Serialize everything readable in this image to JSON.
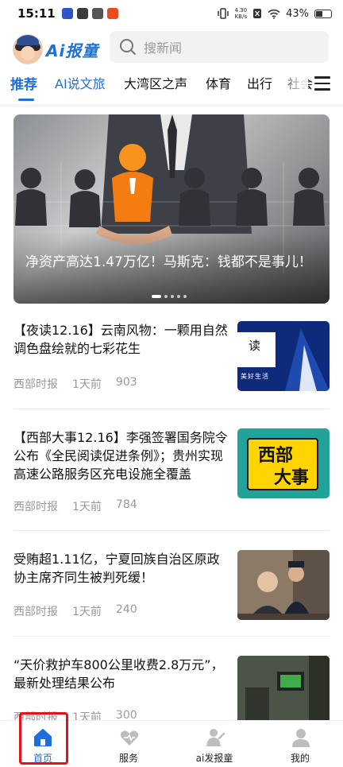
{
  "status_bar": {
    "time": "15:11",
    "net_speed_value": "4.30",
    "net_speed_unit": "KB/s",
    "battery": "43%"
  },
  "header": {
    "logo_text": "Ai报童",
    "search_placeholder": "搜新闻"
  },
  "tabs": [
    {
      "label": "推荐"
    },
    {
      "label": "AI说文旅"
    },
    {
      "label": "大湾区之声"
    },
    {
      "label": "体育"
    },
    {
      "label": "出行"
    },
    {
      "label": "社会"
    }
  ],
  "banner": {
    "caption": "净资产高达1.47万亿！马斯克：钱都不是事儿！"
  },
  "news": [
    {
      "title": "【夜读12.16】云南风物：一颗用自然调色盘绘就的七彩花生",
      "source": "西部时报",
      "time": "1天前",
      "views": "903",
      "thumb_text": "读",
      "thumb_sub": "美好生活"
    },
    {
      "title": "【西部大事12.16】李强签署国务院令公布《全民阅读促进条例》；贵州实现高速公路服务区充电设施全覆盖",
      "source": "西部时报",
      "time": "1天前",
      "views": "784",
      "thumb_line1": "西部",
      "thumb_line2": "大事"
    },
    {
      "title": "受贿超1.11亿，宁夏回族自治区原政协主席齐同生被判死缓！",
      "source": "西部时报",
      "time": "1天前",
      "views": "240"
    },
    {
      "title": "“天价救护车800公里收费2.8万元”，最新处理结果公布",
      "source": "西部时报",
      "time": "1天前",
      "views": "300"
    }
  ],
  "bottom_nav": [
    {
      "label": "首页"
    },
    {
      "label": "服务"
    },
    {
      "label": "ai发报童"
    },
    {
      "label": "我的"
    }
  ],
  "colors": {
    "accent": "#1e6fd9",
    "highlight": "#e0141e"
  }
}
